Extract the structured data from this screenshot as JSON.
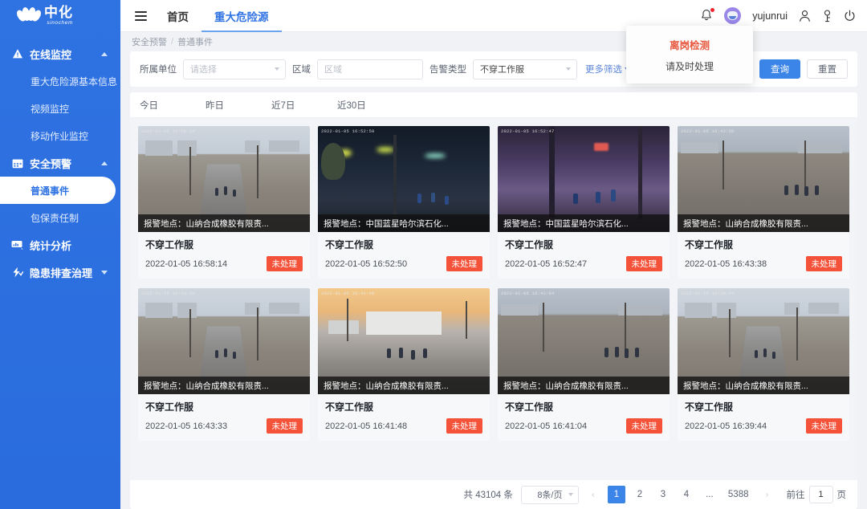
{
  "brand": {
    "cn": "中化",
    "en": "sinochem",
    "logo_icon": "lotus-logo-icon"
  },
  "sidebar": {
    "groups": [
      {
        "label": "在线监控",
        "icon": "warning-triangle-icon",
        "expanded": true,
        "items": [
          {
            "label": "重大危险源基本信息",
            "active": false
          },
          {
            "label": "视频监控",
            "active": false
          },
          {
            "label": "移动作业监控",
            "active": false
          }
        ]
      },
      {
        "label": "安全预警",
        "icon": "calendar-icon",
        "expanded": true,
        "items": [
          {
            "label": "普通事件",
            "active": true
          },
          {
            "label": "包保责任制",
            "active": false
          }
        ]
      },
      {
        "label": "统计分析",
        "icon": "chart-monitor-icon",
        "expanded": false,
        "items": []
      },
      {
        "label": "隐患排查治理",
        "icon": "flash-check-icon",
        "expanded": false,
        "items": []
      }
    ]
  },
  "header": {
    "menu_icon": "hamburger-menu-icon",
    "tabs": [
      {
        "label": "首页",
        "active": false
      },
      {
        "label": "重大危险源",
        "active": true
      }
    ],
    "bell_icon": "bell-icon",
    "username": "yujunrui",
    "user_icon": "user-icon",
    "key_icon": "key-icon",
    "power_icon": "power-icon"
  },
  "notification": {
    "title": "离岗检测",
    "message": "请及时处理",
    "title_color": "#e8593f"
  },
  "breadcrumb": {
    "parent": "安全预警",
    "separator": "/",
    "current": "普通事件"
  },
  "filters": {
    "unit_label": "所属单位",
    "unit_placeholder": "请选择",
    "area_label": "区域",
    "area_placeholder": "区域",
    "alarm_type_label": "告警类型",
    "alarm_type_value": "不穿工作服",
    "more_label": "更多筛选",
    "search_button": "查询",
    "reset_button": "重置"
  },
  "date_tabs": [
    {
      "label": "今日"
    },
    {
      "label": "昨日"
    },
    {
      "label": "近7日"
    },
    {
      "label": "近30日"
    }
  ],
  "cards": [
    {
      "address": "报警地点：山纳合成橡胶有限责...",
      "title": "不穿工作服",
      "time": "2022-01-05 16:58:14",
      "status": "未处理",
      "cam_ts": "2022-01-05 16:58:14",
      "scene": "road-day"
    },
    {
      "address": "报警地点：中国蓝星哈尔滨石化...",
      "title": "不穿工作服",
      "time": "2022-01-05 16:52:50",
      "status": "未处理",
      "cam_ts": "2022-01-05 16:52:50",
      "scene": "night"
    },
    {
      "address": "报警地点：中国蓝星哈尔滨石化...",
      "title": "不穿工作服",
      "time": "2022-01-05 16:52:47",
      "status": "未处理",
      "cam_ts": "2022-01-05 16:52:47",
      "scene": "purple"
    },
    {
      "address": "报警地点：山纳合成橡胶有限责...",
      "title": "不穿工作服",
      "time": "2022-01-05 16:43:38",
      "status": "未处理",
      "cam_ts": "2022-01-05 16:43:38",
      "scene": "road-wide"
    },
    {
      "address": "报警地点：山纳合成橡胶有限责...",
      "title": "不穿工作服",
      "time": "2022-01-05 16:43:33",
      "status": "未处理",
      "cam_ts": "2022-01-05 16:43:33",
      "scene": "road-day"
    },
    {
      "address": "报警地点：山纳合成橡胶有限责...",
      "title": "不穿工作服",
      "time": "2022-01-05 16:41:48",
      "status": "未处理",
      "cam_ts": "2022-01-05 16:41:48",
      "scene": "dusk"
    },
    {
      "address": "报警地点：山纳合成橡胶有限责...",
      "title": "不穿工作服",
      "time": "2022-01-05 16:41:04",
      "status": "未处理",
      "cam_ts": "2022-01-05 16:41:04",
      "scene": "road-wide"
    },
    {
      "address": "报警地点：山纳合成橡胶有限责...",
      "title": "不穿工作服",
      "time": "2022-01-05 16:39:44",
      "status": "未处理",
      "cam_ts": "2022-01-05 16:39:44",
      "scene": "road-day"
    }
  ],
  "pagination": {
    "total_text": "共 43104 条",
    "page_size": "8条/页",
    "prev": "‹",
    "pages": [
      "1",
      "2",
      "3",
      "4",
      "...",
      "5388"
    ],
    "active_page": "1",
    "next": "›",
    "jump_label": "前往",
    "jump_value": "1",
    "jump_unit": "页"
  },
  "colors": {
    "sidebar": "#2f72e2",
    "primary": "#3b84e8",
    "badge": "#f5523a",
    "alert": "#e8593f"
  }
}
